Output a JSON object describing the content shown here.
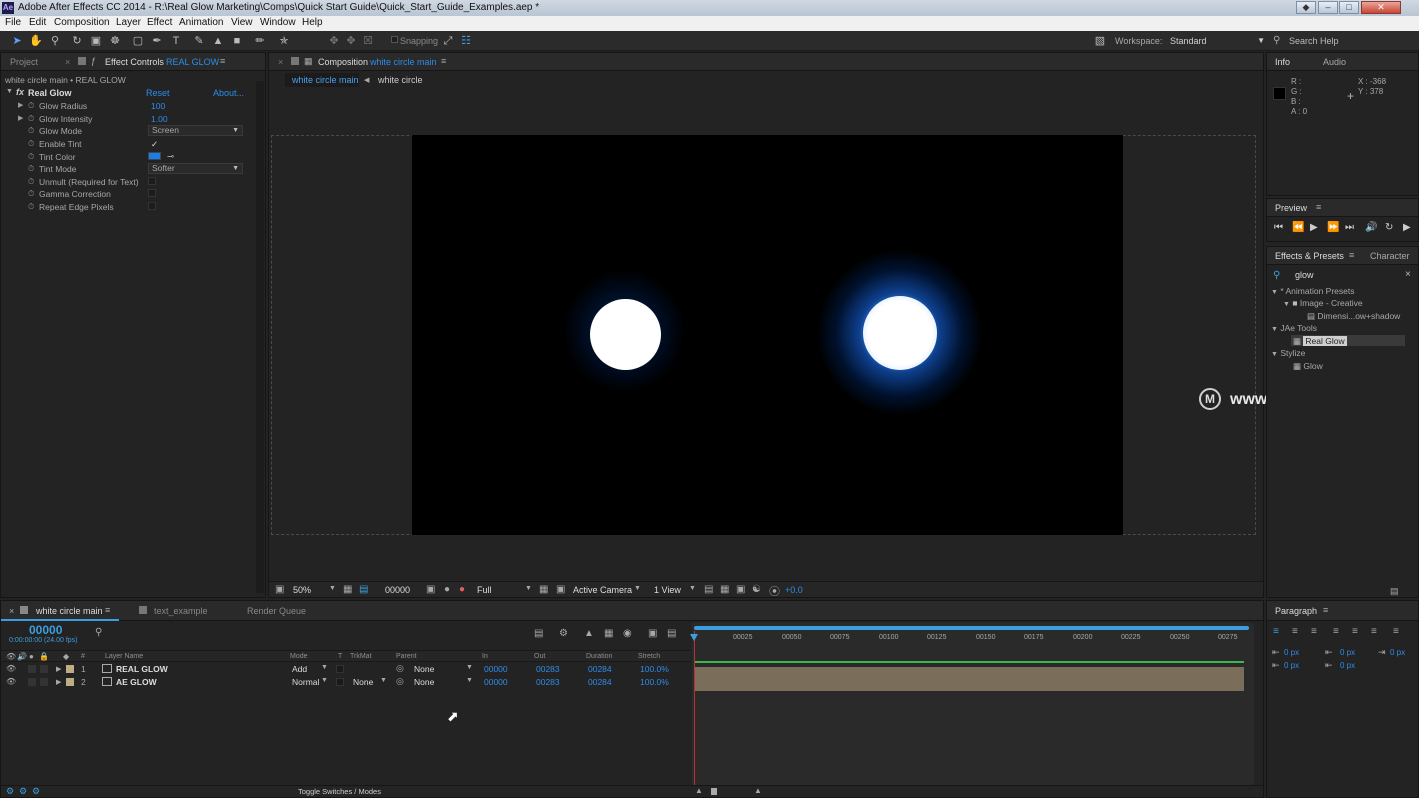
{
  "window": {
    "app_icon": "Ae",
    "title": "Adobe After Effects CC 2014 - R:\\Real Glow Marketing\\Comps\\Quick Start Guide\\Quick_Start_Guide_Examples.aep *"
  },
  "menu": [
    "File",
    "Edit",
    "Composition",
    "Layer",
    "Effect",
    "Animation",
    "View",
    "Window",
    "Help"
  ],
  "toolbar": {
    "snapping": "Snapping",
    "workspace_label": "Workspace:",
    "workspace_value": "Standard",
    "search_help": "Search Help"
  },
  "effect_panel": {
    "tab_project": "Project",
    "tab_effect_controls": "Effect Controls",
    "tab_layer": "REAL GLOW",
    "breadcrumb": "white circle main • REAL GLOW",
    "effect_name": "Real Glow",
    "reset": "Reset",
    "about": "About...",
    "params": [
      {
        "label": "Glow Radius",
        "value": "100"
      },
      {
        "label": "Glow Intensity",
        "value": "1.00"
      },
      {
        "label": "Glow Mode",
        "value": "Screen"
      },
      {
        "label": "Enable Tint",
        "value": "✓"
      },
      {
        "label": "Tint Color",
        "value": ""
      },
      {
        "label": "Tint Mode",
        "value": "Softer"
      },
      {
        "label": "Unmult (Required for Text)",
        "value": ""
      },
      {
        "label": "Gamma Correction",
        "value": ""
      },
      {
        "label": "Repeat Edge Pixels",
        "value": ""
      }
    ],
    "tint_color": "#1a7ee8"
  },
  "composition": {
    "tab_label": "Composition",
    "tab_name": "white circle main",
    "flow_active": "white circle main",
    "flow_child": "white circle",
    "footer": {
      "zoom": "50%",
      "timecode": "00000",
      "resolution": "Full",
      "camera": "Active Camera",
      "view": "1 View",
      "exposure": "+0.0"
    }
  },
  "watermark": "www.MacDown.com",
  "info_panel": {
    "tab_info": "Info",
    "tab_audio": "Audio",
    "r": "R :",
    "g": "G :",
    "b": "B :",
    "a": "A : 0",
    "x": "X : -368",
    "y": "Y : 378"
  },
  "preview_panel": {
    "tab": "Preview"
  },
  "effects_presets": {
    "tab": "Effects & Presets",
    "tab_character": "Character",
    "search": "glow",
    "tree": [
      {
        "label": "* Animation Presets"
      },
      {
        "label": "Image - Creative"
      },
      {
        "label": "Dimensi...ow+shadow"
      },
      {
        "label": "JAe Tools"
      },
      {
        "label": "Real Glow"
      },
      {
        "label": "Stylize"
      },
      {
        "label": "Glow"
      }
    ]
  },
  "timeline": {
    "tab_active": "white circle main",
    "tab2": "text_example",
    "tab3": "Render Queue",
    "timecode": "00000",
    "subtimecode": "0:00:00:00 (24.00 fps)",
    "headers": {
      "num": "#",
      "layer_name": "Layer Name",
      "mode": "Mode",
      "t": "T",
      "trkmat": "TrkMat",
      "parent": "Parent",
      "in": "In",
      "out": "Out",
      "duration": "Duration",
      "stretch": "Stretch"
    },
    "layers": [
      {
        "num": "1",
        "name": "REAL GLOW",
        "mode": "Add",
        "trkmat": "",
        "parent": "None",
        "in": "00000",
        "out": "00283",
        "duration": "00284",
        "stretch": "100.0%"
      },
      {
        "num": "2",
        "name": "AE GLOW",
        "mode": "Normal",
        "trkmat": "None",
        "parent": "None",
        "in": "00000",
        "out": "00283",
        "duration": "00284",
        "stretch": "100.0%"
      }
    ],
    "ruler": [
      "00025",
      "00050",
      "00075",
      "00100",
      "00125",
      "00150",
      "00175",
      "00200",
      "00225",
      "00250",
      "00275"
    ],
    "toggle_label": "Toggle Switches / Modes"
  },
  "paragraph_panel": {
    "tab": "Paragraph",
    "px_values": [
      "0 px",
      "0 px",
      "0 px",
      "0 px",
      "0 px"
    ]
  }
}
